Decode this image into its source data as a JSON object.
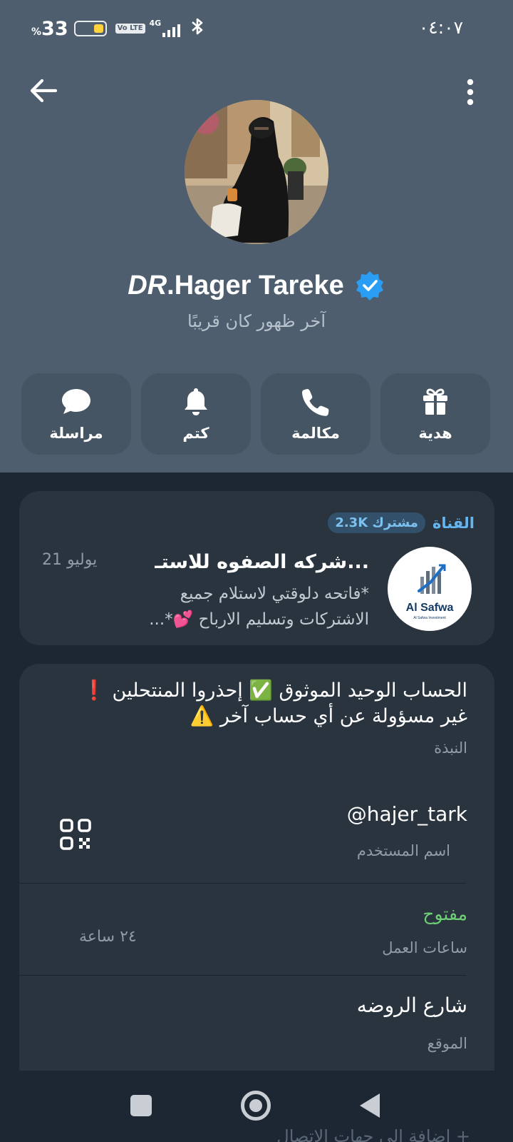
{
  "status_bar": {
    "battery_percent": "33",
    "percent_sign": "%",
    "network": "4G",
    "volte": "Vo LTE",
    "time": "٠٤:٠٧"
  },
  "profile": {
    "name_prefix": "DR",
    "name_rest": ".Hager Tareke",
    "last_seen": "آخر ظهور كان قريبًا",
    "verified": true
  },
  "actions": [
    {
      "label": "مراسلة",
      "icon": "chat-bubble-icon"
    },
    {
      "label": "كتم",
      "icon": "bell-icon"
    },
    {
      "label": "مكالمة",
      "icon": "phone-icon"
    },
    {
      "label": "هدية",
      "icon": "gift-icon"
    }
  ],
  "channel": {
    "type": "القناة",
    "subscribers": "2.3K مشترك",
    "title": "شركه الصفوه للاستـ...",
    "date": "21 يوليو",
    "message": "*فاتحه دلوقتي لاستلام جميع الاشتركات وتسليم الارباح 💕*...",
    "logo_text": "Al Safwa",
    "logo_sub": "Al Safwa Investment"
  },
  "info": {
    "bio": "الحساب الوحيد الموثوق ✅ إحذروا المنتحلين ❗ غير مسؤولة عن أي حساب آخر ⚠️",
    "bio_label": "النبذة",
    "username": "@hajer_tark",
    "username_label": "اسم المستخدم",
    "hours_status": "مفتوح",
    "hours_label": "ساعات العمل",
    "hours_value": "٢٤ ساعة",
    "location": "شارع الروضه",
    "location_label": "الموقع"
  },
  "behind_text": "+ إضافة إلى جهات الاتصال",
  "colors": {
    "header_bg": "#4e5e6e",
    "body_bg": "#1d2733",
    "card_bg": "#29343f",
    "accent_blue": "#64b5ef",
    "open_green": "#6fcf76",
    "verified_blue": "#2a9ef4"
  }
}
